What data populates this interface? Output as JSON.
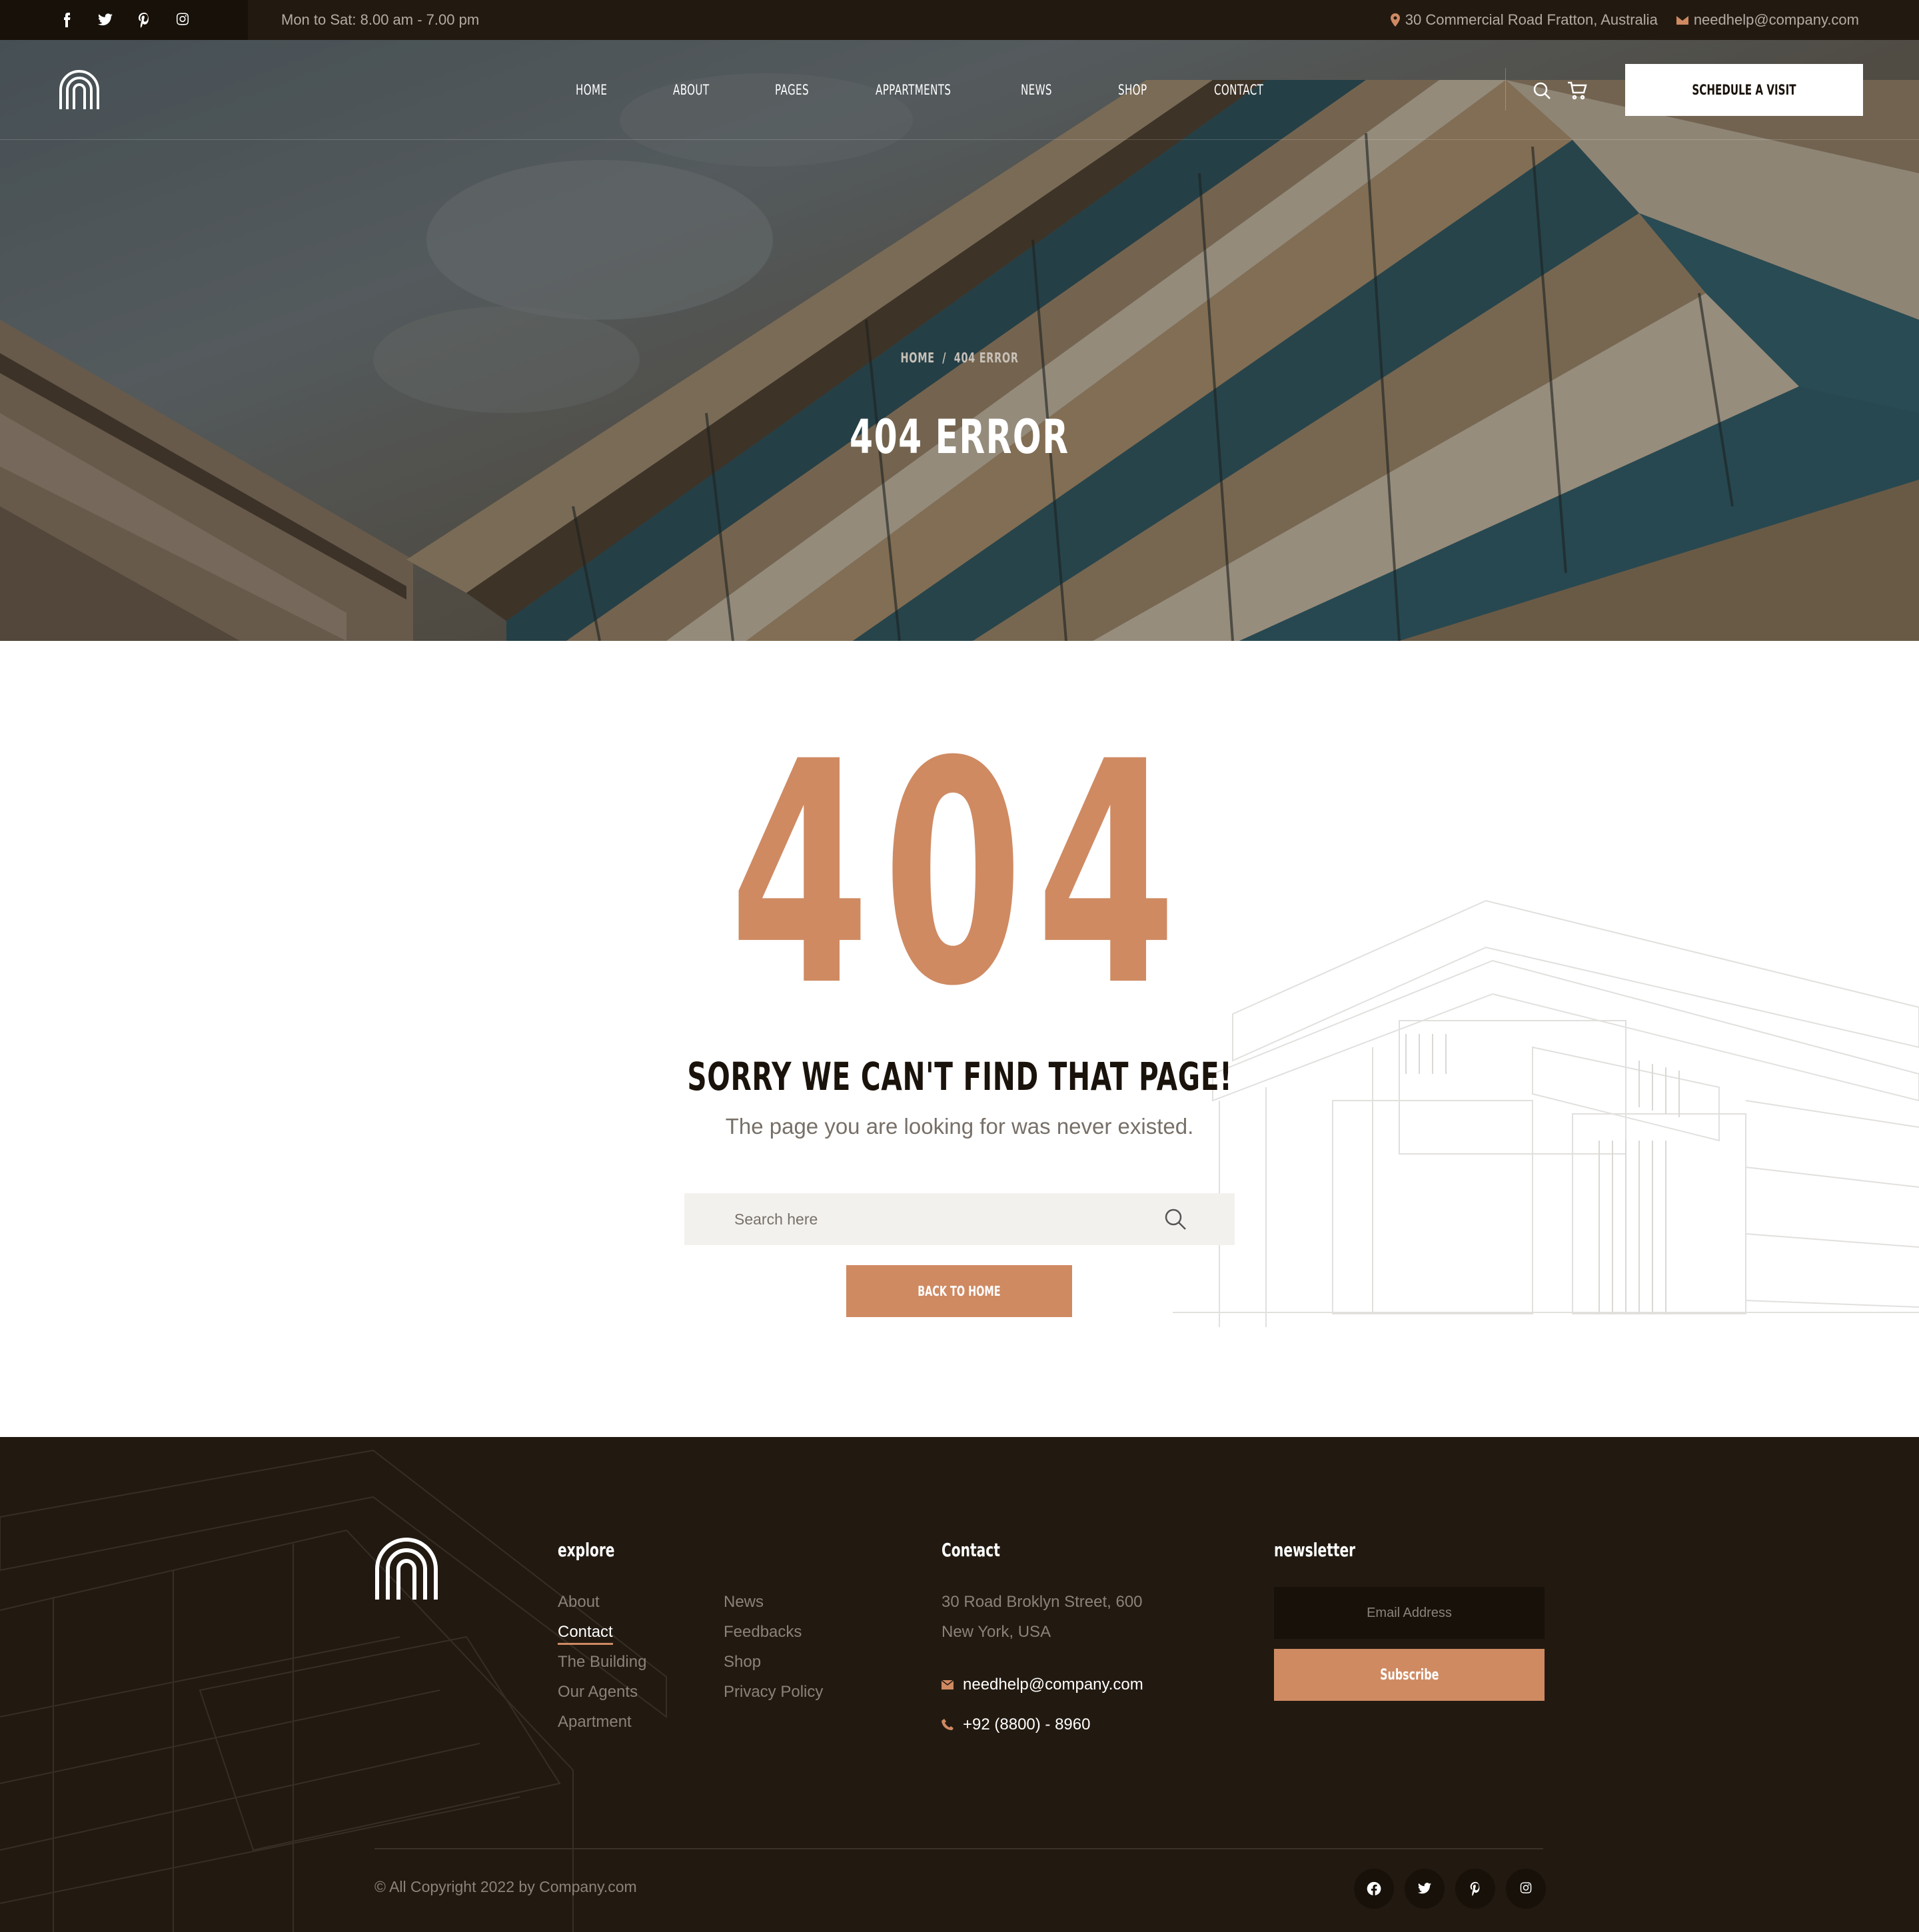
{
  "topbar": {
    "social": [
      "facebook-icon",
      "twitter-icon",
      "pinterest-icon",
      "instagram-icon"
    ],
    "hours": "Mon to Sat: 8.00 am - 7.00 pm",
    "address": "30 Commercial Road Fratton, Australia",
    "email": "needhelp@company.com"
  },
  "nav": {
    "items": [
      {
        "label": "Home"
      },
      {
        "label": "About"
      },
      {
        "label": "Pages"
      },
      {
        "label": "Appartments"
      },
      {
        "label": "News"
      },
      {
        "label": "Shop"
      },
      {
        "label": "Contact"
      }
    ],
    "active": "About",
    "cta": "Schedule a Visit"
  },
  "hero": {
    "breadcrumb_home": "HOME",
    "breadcrumb_sep": "/",
    "breadcrumb_current": "404 ERROR",
    "title": "404 ERROR"
  },
  "error": {
    "code": "404",
    "heading": "SORRY WE CAN'T FIND THAT PAGE!",
    "message": "The page you are looking for was never existed.",
    "search_placeholder": "Search here",
    "button": "BACK TO HOME"
  },
  "footer": {
    "explore_title": "explore",
    "explore_col1": [
      "About",
      "Contact",
      "The Building",
      "Our Agents",
      "Apartment"
    ],
    "explore_col2": [
      "News",
      "Feedbacks",
      "Shop",
      "Privacy Policy"
    ],
    "active_link": "Contact",
    "contact_title": "Contact",
    "address_line1": "30 Road Broklyn Street, 600",
    "address_line2": "New York, USA",
    "email": "needhelp@company.com",
    "phone": "+92 (8800) - 8960",
    "newsletter_title": "newsletter",
    "email_placeholder": "Email Address",
    "subscribe": "Subscribe",
    "copyright": "© All Copyright 2022 by Company.com",
    "social": [
      "facebook-icon",
      "twitter-icon",
      "pinterest-icon",
      "instagram-icon"
    ]
  },
  "colors": {
    "accent": "#cf8a62",
    "dark": "#221a11",
    "darker": "#171109"
  }
}
